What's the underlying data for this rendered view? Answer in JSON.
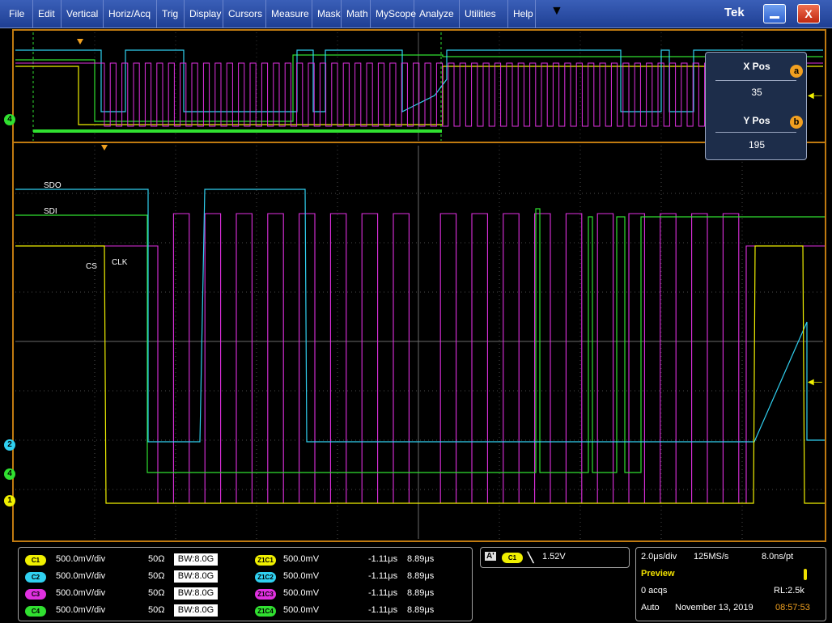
{
  "menu": [
    "File",
    "Edit",
    "Vertical",
    "Horiz/Acq",
    "Trig",
    "Display",
    "Cursors",
    "Measure",
    "Mask",
    "Math",
    "MyScope",
    "Analyze",
    "Utilities",
    "Help"
  ],
  "menu_more_icon": "▼",
  "brand": "Tek",
  "close_glyph": "X",
  "signal_labels": {
    "sdo": "SDO",
    "sdi": "SDI",
    "cs": "CS",
    "clk": "CLK"
  },
  "channel_markers": {
    "ch2": "2",
    "ch4": "4",
    "ch1": "1"
  },
  "xy_panel": {
    "x_title": "X Pos",
    "x_value": "35",
    "x_knob": "a",
    "y_title": "Y Pos",
    "y_value": "195",
    "y_knob": "b"
  },
  "colors": {
    "ch1": "#f0f000",
    "ch2": "#30d0f0",
    "ch3": "#e030e0",
    "ch4": "#30e030",
    "grid_border": "#c07a10"
  },
  "channels": [
    {
      "badge": "C1",
      "scale": "500.0mV/div",
      "imp": "50Ω",
      "bw": "BW:8.0G",
      "zbadge": "Z1C1",
      "zscale": "500.0mV",
      "t1": "-1.11μs",
      "t2": "8.89μs"
    },
    {
      "badge": "C2",
      "scale": "500.0mV/div",
      "imp": "50Ω",
      "bw": "BW:8.0G",
      "zbadge": "Z1C2",
      "zscale": "500.0mV",
      "t1": "-1.11μs",
      "t2": "8.89μs"
    },
    {
      "badge": "C3",
      "scale": "500.0mV/div",
      "imp": "50Ω",
      "bw": "BW:8.0G",
      "zbadge": "Z1C3",
      "zscale": "500.0mV",
      "t1": "-1.11μs",
      "t2": "8.89μs"
    },
    {
      "badge": "C4",
      "scale": "500.0mV/div",
      "imp": "50Ω",
      "bw": "BW:8.0G",
      "zbadge": "Z1C4",
      "zscale": "500.0mV",
      "t1": "-1.11μs",
      "t2": "8.89μs"
    }
  ],
  "trigger": {
    "mode": "A'",
    "source": "C1",
    "slope_icon": "falling-edge-icon",
    "slope_glyph": "╲",
    "level": "1.52V"
  },
  "acq": {
    "timebase": "2.0μs/div",
    "rate": "125MS/s",
    "resolution": "8.0ns/pt",
    "state": "Preview",
    "acqs": "0 acqs",
    "rl": "RL:2.5k",
    "mode": "Auto",
    "date": "November 13, 2019",
    "time": "08:57:53"
  }
}
